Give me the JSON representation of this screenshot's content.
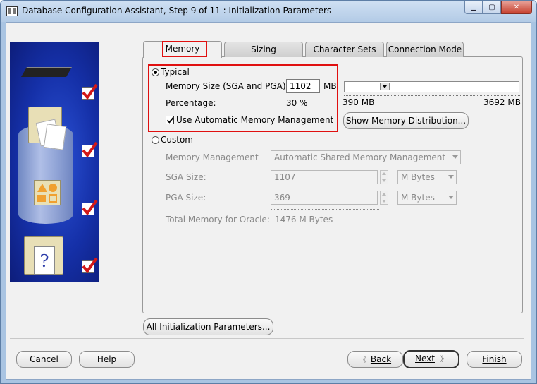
{
  "window": {
    "title": "Database Configuration Assistant, Step 9 of 11 : Initialization Parameters",
    "minimize_label": "▁",
    "maximize_label": "▢",
    "close_label": "✕"
  },
  "tabs": [
    {
      "label": "Memory",
      "active": true
    },
    {
      "label": "Sizing",
      "active": false
    },
    {
      "label": "Character Sets",
      "active": false
    },
    {
      "label": "Connection Mode",
      "active": false
    }
  ],
  "typical": {
    "label": "Typical",
    "selected": true,
    "memory_size_label": "Memory Size (SGA and PGA):",
    "memory_size_value": "1102",
    "memory_size_unit": "MB",
    "percentage_label": "Percentage:",
    "percentage_value": "30 %",
    "auto_memory_label": "Use Automatic Memory Management",
    "auto_memory_checked": true,
    "slider_min_label": "390 MB",
    "slider_max_label": "3692 MB",
    "slider_fraction": 0.215,
    "show_distribution_label": "Show Memory Distribution..."
  },
  "custom": {
    "label": "Custom",
    "selected": false,
    "memory_management_label": "Memory Management",
    "memory_management_value": "Automatic Shared Memory Management",
    "sga_label": "SGA Size:",
    "sga_value": "1107",
    "sga_unit": "M Bytes",
    "pga_label": "PGA Size:",
    "pga_value": "369",
    "pga_unit": "M Bytes",
    "total_label": "Total Memory for Oracle:",
    "total_value": "1476 M Bytes"
  },
  "buttons": {
    "all_params": "All Initialization Parameters...",
    "cancel": "Cancel",
    "help": "Help",
    "back": "Back",
    "next": "Next",
    "finish": "Finish",
    "back_arrow": "《",
    "next_arrow": "》"
  },
  "colors": {
    "highlight_red": "#e01010",
    "titlebar": "#b3cbe6",
    "side_panel_blue": "#1530a8"
  }
}
